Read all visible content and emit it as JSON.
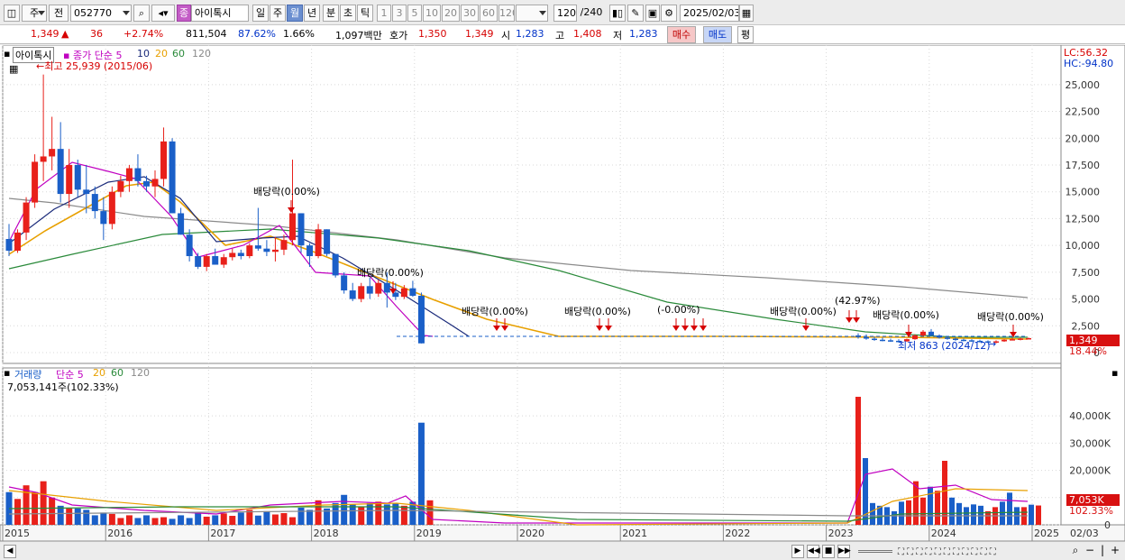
{
  "toolbar": {
    "market": "주",
    "prev": "전",
    "code": "052770",
    "badge": "종",
    "stock_name": "아이톡시",
    "periods": [
      "일",
      "주",
      "월",
      "년",
      "분",
      "초",
      "틱"
    ],
    "selected_period": "월",
    "intervals": [
      "1",
      "3",
      "5",
      "10",
      "20",
      "30",
      "60",
      "120"
    ],
    "count": "120",
    "count_total": "/240",
    "date": "2025/02/03"
  },
  "quote": {
    "price": "1,349",
    "change": "36",
    "change_pct": "+2.74%",
    "volume": "811,504",
    "vol_ratio": "87.62%",
    "turnover": "1.66%",
    "amount": "1,097백만",
    "bid_label": "호가",
    "ask_price": "1,350",
    "bid_price": "1,349",
    "open_label": "시",
    "open": "1,283",
    "high_label": "고",
    "high": "1,408",
    "low_label": "저",
    "low": "1,283",
    "buy_btn": "매수",
    "sell_btn": "매도",
    "eval_btn": "평"
  },
  "price_panel": {
    "stock_label": "아이톡시",
    "legend_prefix": "종가 단순",
    "ma": [
      "5",
      "10",
      "20",
      "60",
      "120"
    ],
    "max_label": "최고 25,939 (2015/06)",
    "min_label": "최저 863 (2024/12)",
    "lc": "LC:56.32",
    "hc": "HC:-94.80",
    "current_tag": "1,349",
    "pct_tag": "18.44%",
    "pct_tag2": "42.97%",
    "dividend": "배당락(0.00%)",
    "dividend_cluster_1": "배당락(0.00%)",
    "dividend_cluster_2": "배당락(0.00%)",
    "dividend_cluster_3": "(-0.00%)",
    "dividend_cluster_4": "배당락(0.00%)",
    "dividend_cluster_5": "(0.00%)",
    "dividend_cluster_6": "(42.97%)"
  },
  "volume_panel": {
    "title": "거래량",
    "legend_prefix": "단순",
    "ma": [
      "5",
      "20",
      "60",
      "120"
    ],
    "info": "7,053,141주(102.33%)",
    "tag_value": "7,053K",
    "tag_pct": "102.33%"
  },
  "colors": {
    "up": "#e8201a",
    "down": "#1a5fc8",
    "ma5": "#c000c0",
    "ma10": "#1a2a7a",
    "ma20": "#e8a000",
    "ma60": "#2a8a3a",
    "ma120": "#8a8a8a"
  },
  "chart_data": {
    "type": "candlestick",
    "price_axis": {
      "ylim": [
        0,
        26500
      ],
      "ticks": [
        "25,000",
        "22,500",
        "20,000",
        "17,500",
        "15,000",
        "12,500",
        "10,000",
        "7,500",
        "5,000",
        "2,500",
        "0"
      ]
    },
    "volume_axis": {
      "ylim": [
        0,
        48000
      ],
      "ticks": [
        "40,000K",
        "30,000K",
        "20,000K",
        "10,000K",
        "0"
      ]
    },
    "x_years": [
      "2015",
      "2016",
      "2017",
      "2018",
      "2019",
      "2020",
      "2021",
      "2022",
      "2023",
      "2024",
      "2025"
    ],
    "x_last_label": "02/03",
    "candles_2015_2018": [
      [
        10600,
        12000,
        9000,
        9500
      ],
      [
        9500,
        11500,
        9300,
        11200
      ],
      [
        11200,
        14500,
        10500,
        14000
      ],
      [
        14000,
        18500,
        13500,
        17800
      ],
      [
        17800,
        25939,
        16000,
        18300
      ],
      [
        18300,
        22000,
        17000,
        19000
      ],
      [
        19000,
        21500,
        14000,
        14800
      ],
      [
        14800,
        19000,
        13500,
        17500
      ],
      [
        17500,
        18000,
        14500,
        15200
      ],
      [
        15200,
        17500,
        13000,
        14800
      ],
      [
        14800,
        15500,
        12500,
        13200
      ],
      [
        13200,
        14500,
        10500,
        12000
      ],
      [
        12000,
        15500,
        11500,
        15000
      ],
      [
        15000,
        16500,
        14500,
        16000
      ],
      [
        16000,
        17500,
        15000,
        17200
      ],
      [
        17200,
        18500,
        15500,
        16000
      ],
      [
        16000,
        16500,
        15000,
        15500
      ],
      [
        15500,
        17000,
        14500,
        16200
      ],
      [
        16200,
        21000,
        15500,
        19700
      ],
      [
        19700,
        20000,
        13000,
        13000
      ],
      [
        13000,
        13500,
        11500,
        11000
      ],
      [
        11000,
        11500,
        8500,
        9000
      ],
      [
        9000,
        9300,
        7800,
        8000
      ],
      [
        8000,
        9200,
        7600,
        9000
      ],
      [
        9000,
        9700,
        8200,
        8200
      ],
      [
        8200,
        9200,
        7900,
        8900
      ],
      [
        8900,
        9700,
        8600,
        9300
      ],
      [
        9300,
        9600,
        8700,
        9000
      ],
      [
        9000,
        10200,
        8800,
        10000
      ],
      [
        10000,
        13500,
        9500,
        9700
      ],
      [
        9700,
        10500,
        9000,
        9400
      ],
      [
        9400,
        10800,
        8500,
        9600
      ],
      [
        9600,
        11000,
        9100,
        10500
      ],
      [
        10500,
        18000,
        10000,
        13000
      ],
      [
        13000,
        11000,
        9300,
        10000
      ],
      [
        10000,
        10200,
        8000,
        9000
      ],
      [
        9000,
        12000,
        8800,
        11500
      ],
      [
        11500,
        11000,
        9000,
        9200
      ],
      [
        9200,
        9000,
        7000,
        7200
      ],
      [
        7200,
        7500,
        5500,
        5800
      ],
      [
        5800,
        6500,
        4800,
        5000
      ],
      [
        5000,
        6500,
        4700,
        6200
      ],
      [
        6200,
        7000,
        5000,
        5500
      ],
      [
        5500,
        6800,
        5200,
        6500
      ],
      [
        6500,
        7500,
        4200,
        5600
      ],
      [
        5600,
        6500,
        4900,
        5200
      ],
      [
        5200,
        6300,
        5000,
        6000
      ],
      [
        6000,
        6700,
        5200,
        5300
      ],
      [
        5300,
        5600,
        850,
        863
      ]
    ],
    "volume_bars_2015_2018": [
      12,
      9.5,
      14.5,
      12,
      16,
      10,
      7,
      6,
      6,
      5.5,
      3.5,
      4.5,
      4,
      2.5,
      3.5,
      2.5,
      3.5,
      2.5,
      2.8,
      2.2,
      3.5,
      2.5,
      4.5,
      3,
      3.5,
      4.2,
      3.3,
      4.5,
      5.5,
      3.4,
      5,
      3.8,
      4.3,
      2.8,
      6.3,
      5.5,
      9,
      6,
      8,
      11,
      7.5,
      6.5,
      8,
      8.5,
      7.5,
      8,
      7,
      8.5,
      37.5,
      9
    ],
    "volume_bars_2023_2025": [
      47,
      24.5,
      8,
      7,
      6.5,
      5,
      8.5,
      9,
      16,
      10,
      14,
      12.5,
      23.5,
      10,
      8,
      6.5,
      7.5,
      7,
      5,
      6.5,
      8.5,
      11.8,
      6.5,
      6.5,
      7.4,
      7.1
    ]
  }
}
